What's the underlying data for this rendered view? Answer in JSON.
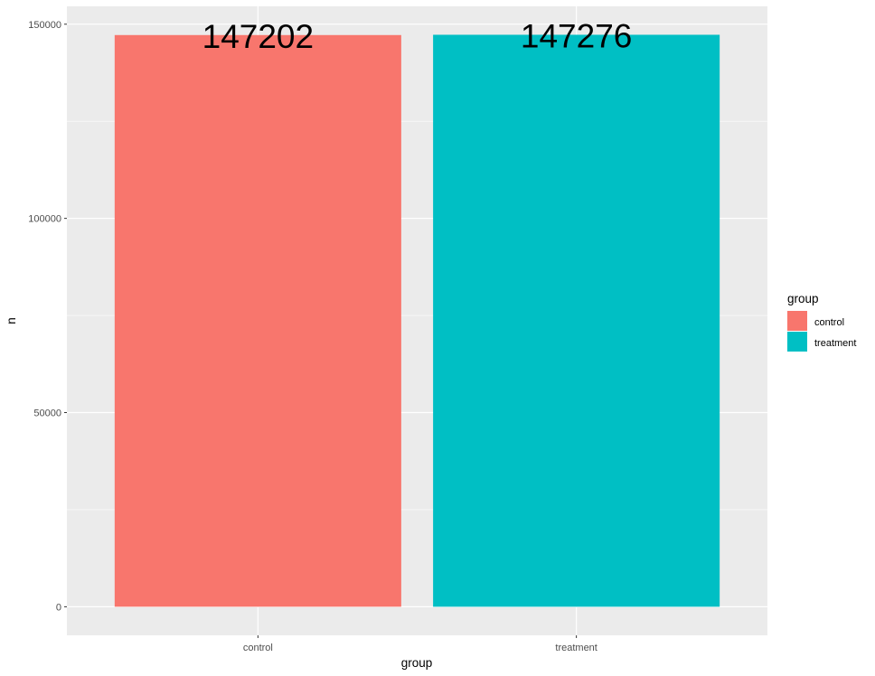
{
  "chart_data": {
    "type": "bar",
    "title": "",
    "xlabel": "group",
    "ylabel": "n",
    "categories": [
      "control",
      "treatment"
    ],
    "values": [
      147202,
      147276
    ],
    "data_labels": [
      "147202",
      "147276"
    ],
    "colors": [
      "#F8766D",
      "#00BFC4"
    ],
    "ylim": [
      -7360,
      154600
    ],
    "yticks": [
      0,
      50000,
      100000,
      150000
    ],
    "ytick_labels": [
      "0",
      "50000",
      "100000",
      "150000"
    ],
    "grid": true,
    "panel_background": "#EBEBEB",
    "legend": {
      "title": "group",
      "position": "right",
      "entries": [
        {
          "label": "control",
          "color": "#F8766D"
        },
        {
          "label": "treatment",
          "color": "#00BFC4"
        }
      ]
    }
  }
}
